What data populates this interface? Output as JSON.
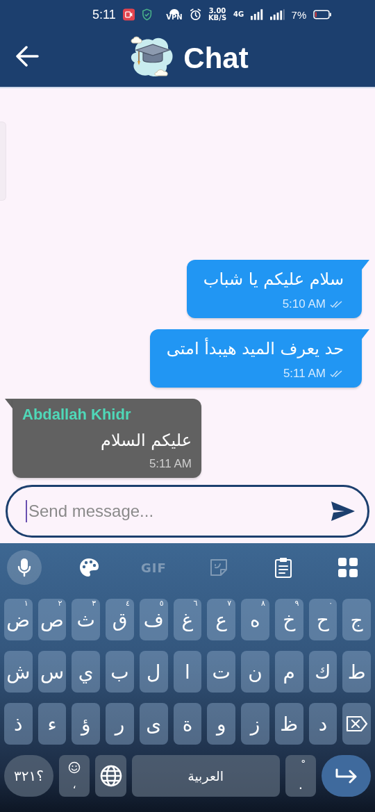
{
  "status_bar": {
    "time": "5:11",
    "vpn": "VPN",
    "speed_value": "3.00",
    "speed_unit": "KB/S",
    "network": "4G",
    "battery": "7%"
  },
  "app_bar": {
    "title": "Chat"
  },
  "messages": [
    {
      "kind": "outgoing",
      "text": "سلام عليكم يا شباب",
      "time": "5:10 AM",
      "read": true
    },
    {
      "kind": "outgoing",
      "text": "حد يعرف الميد هيبدأ امتى",
      "time": "5:11 AM",
      "read": true
    },
    {
      "kind": "incoming",
      "sender": "Abdallah Khidr",
      "text": "عليكم السلام",
      "time": "5:11 AM"
    }
  ],
  "composer": {
    "placeholder": "Send message..."
  },
  "keyboard": {
    "toolbar": [
      {
        "kind": "mic",
        "selected": true,
        "disabled": false
      },
      {
        "kind": "palette",
        "selected": false,
        "disabled": false
      },
      {
        "kind": "gif",
        "label": "GIF",
        "selected": false,
        "disabled": true
      },
      {
        "kind": "sticker",
        "selected": false,
        "disabled": true
      },
      {
        "kind": "clipboard",
        "selected": false,
        "disabled": false
      },
      {
        "kind": "apps",
        "selected": false,
        "disabled": false
      }
    ],
    "rows": [
      [
        {
          "key": "ج"
        },
        {
          "key": "ح",
          "hint": "٠"
        },
        {
          "key": "خ",
          "hint": "٩"
        },
        {
          "key": "ه",
          "hint": "٨"
        },
        {
          "key": "ع",
          "hint": "٧"
        },
        {
          "key": "غ",
          "hint": "٦"
        },
        {
          "key": "ف",
          "hint": "٥"
        },
        {
          "key": "ق",
          "hint": "٤"
        },
        {
          "key": "ث",
          "hint": "٣"
        },
        {
          "key": "ص",
          "hint": "٢"
        },
        {
          "key": "ض",
          "hint": "١"
        }
      ],
      [
        {
          "key": "ط"
        },
        {
          "key": "ك"
        },
        {
          "key": "م"
        },
        {
          "key": "ن"
        },
        {
          "key": "ت"
        },
        {
          "key": "ا"
        },
        {
          "key": "ل"
        },
        {
          "key": "ب"
        },
        {
          "key": "ي"
        },
        {
          "key": "س"
        },
        {
          "key": "ش"
        }
      ],
      [
        {
          "kind": "backspace"
        },
        {
          "key": "د"
        },
        {
          "key": "ظ"
        },
        {
          "key": "ز"
        },
        {
          "key": "و"
        },
        {
          "key": "ة"
        },
        {
          "key": "ى"
        },
        {
          "key": "ر"
        },
        {
          "key": "ؤ"
        },
        {
          "key": "ء"
        },
        {
          "key": "ذ"
        }
      ]
    ],
    "bottom": [
      {
        "kind": "enter"
      },
      {
        "kind": "period",
        "key": ".",
        "hint": "ْ"
      },
      {
        "kind": "space",
        "key": "العربية"
      },
      {
        "kind": "globe"
      },
      {
        "kind": "emoji",
        "key": "،"
      },
      {
        "kind": "symbols",
        "key": "؟٣٢١"
      }
    ]
  }
}
